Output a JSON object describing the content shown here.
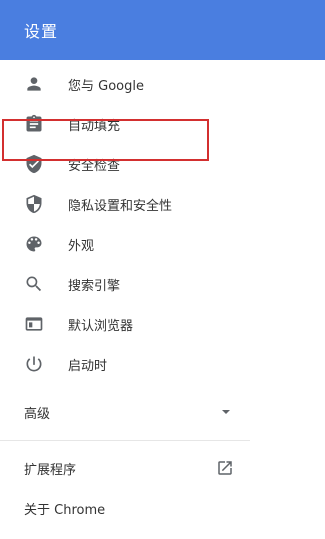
{
  "header": {
    "title": "设置"
  },
  "sidebar": {
    "items": [
      {
        "label": "您与 Google",
        "icon": "person-icon"
      },
      {
        "label": "自动填充",
        "icon": "clipboard-icon"
      },
      {
        "label": "安全检查",
        "icon": "shield-check-icon"
      },
      {
        "label": "隐私设置和安全性",
        "icon": "privacy-shield-icon",
        "highlighted": true
      },
      {
        "label": "外观",
        "icon": "palette-icon"
      },
      {
        "label": "搜索引擎",
        "icon": "search-icon"
      },
      {
        "label": "默认浏览器",
        "icon": "browser-window-icon"
      },
      {
        "label": "启动时",
        "icon": "power-icon"
      }
    ],
    "advanced_label": "高级",
    "footer": {
      "extensions_label": "扩展程序",
      "about_label": "关于 Chrome"
    }
  },
  "colors": {
    "header_bg": "#4a7ee0",
    "header_text": "#ffffff",
    "text": "#333333",
    "icon": "#5f6368",
    "highlight_border": "#d32f2f"
  }
}
